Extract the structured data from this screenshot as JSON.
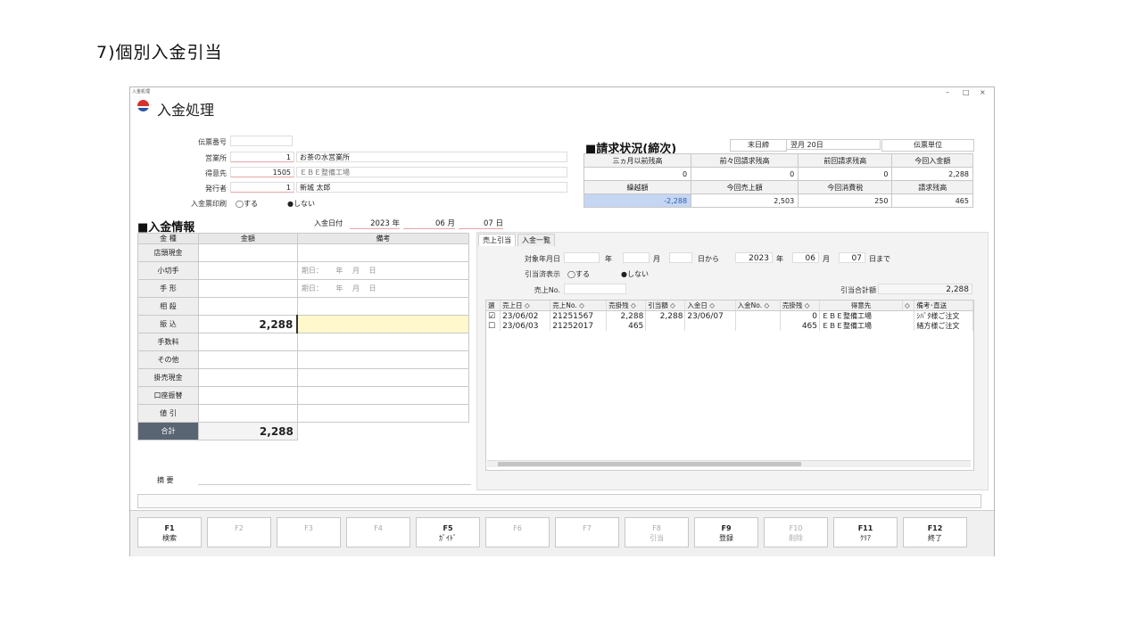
{
  "slide_title": "7)個別入金引当",
  "window": {
    "caption": "入金処理",
    "title": "入金処理",
    "controls": [
      "–",
      "□",
      "×"
    ]
  },
  "header_fields": {
    "slip_no_label": "伝票番号",
    "slip_no": "",
    "office_label": "営業所",
    "office_code": "1",
    "office_name": "お茶の水営業所",
    "customer_label": "得意先",
    "customer_code": "1505",
    "customer_name": "ＥＢＥ整備工場",
    "issuer_label": "発行者",
    "issuer_code": "1",
    "issuer_name": "新城 太郎",
    "print_label": "入金票印刷",
    "print_yes": "◯する",
    "print_no": "●しない"
  },
  "billing": {
    "title": "■請求状況(締次)",
    "close_label": "末日締",
    "pay_label": "翌月 20日",
    "unit_label": "伝票単位",
    "h1": [
      "三ヵ月以前残高",
      "前々回請求残高",
      "前回請求残高",
      "今回入金額"
    ],
    "v1": [
      "0",
      "0",
      "0",
      "2,288"
    ],
    "h2": [
      "繰越額",
      "今回売上額",
      "今回消費税",
      "請求残高"
    ],
    "v2": [
      "-2,288",
      "2,503",
      "250",
      "465"
    ],
    "highlight_color": "#c5d6f2"
  },
  "payment": {
    "title": "■入金情報",
    "date_label": "入金日付",
    "year": "2023",
    "year_unit": "年",
    "month": "06",
    "month_unit": "月",
    "day": "07",
    "day_unit": "日",
    "col_kind": "金 種",
    "col_amount": "金額",
    "col_note": "備考",
    "rows": [
      {
        "kind": "店頭現金",
        "amount": "",
        "note": ""
      },
      {
        "kind": "小切手",
        "amount": "",
        "note": "期日：　　 年　 月　 日"
      },
      {
        "kind": "手 形",
        "amount": "",
        "note": "期日：　　 年　 月　 日"
      },
      {
        "kind": "相 殺",
        "amount": "",
        "note": ""
      },
      {
        "kind": "振 込",
        "amount": "2,288",
        "note": ""
      },
      {
        "kind": "手数料",
        "amount": "",
        "note": ""
      },
      {
        "kind": "その他",
        "amount": "",
        "note": ""
      },
      {
        "kind": "掛売現金",
        "amount": "",
        "note": ""
      },
      {
        "kind": "口座振替",
        "amount": "",
        "note": ""
      },
      {
        "kind": "値 引",
        "amount": "",
        "note": ""
      }
    ],
    "total_label": "合計",
    "total_amount": "2,288",
    "summary_label": "摘 要",
    "summary": ""
  },
  "tabs": [
    "売上引当",
    "入金一覧"
  ],
  "filter": {
    "target_date_label": "対象年月日",
    "year_unit": "年",
    "month_unit": "月",
    "from_label": "日から",
    "to_year": "2023",
    "to_month": "06",
    "to_day": "07",
    "to_label": "日まで",
    "show_label": "引当済表示",
    "show_yes": "◯する",
    "show_no": "●しない",
    "sales_no_label": "売上No.",
    "alloc_total_label": "引当合計額",
    "alloc_total": "2,288"
  },
  "grid": {
    "headers": [
      "選",
      "売上日 ◇",
      "売上No. ◇",
      "売掛残 ◇",
      "引当額 ◇",
      "入金日 ◇",
      "入金No. ◇",
      "売掛残 ◇",
      "得意先",
      "◇",
      "備考･直送"
    ],
    "rows": [
      {
        "sel": "☑",
        "date": "23/06/02",
        "no": "21251567",
        "bal": "2,288",
        "alloc": "2,288",
        "pdate": "23/06/07",
        "pno": "",
        "bal2": "0",
        "cust": "ＥＢＥ整備工場",
        "note": "ｼﾊﾞﾀ様ご注文"
      },
      {
        "sel": "☐",
        "date": "23/06/03",
        "no": "21252017",
        "bal": "465",
        "alloc": "",
        "pdate": "",
        "pno": "",
        "bal2": "465",
        "cust": "ＥＢＥ整備工場",
        "note": "緒方様ご注文"
      }
    ]
  },
  "fkeys": [
    {
      "key": "F1",
      "label": "検索",
      "enabled": true
    },
    {
      "key": "F2",
      "label": "",
      "enabled": false
    },
    {
      "key": "F3",
      "label": "",
      "enabled": false
    },
    {
      "key": "F4",
      "label": "",
      "enabled": false
    },
    {
      "key": "F5",
      "label": "ｶﾞｲﾄﾞ",
      "enabled": true
    },
    {
      "key": "F6",
      "label": "",
      "enabled": false
    },
    {
      "key": "F7",
      "label": "",
      "enabled": false
    },
    {
      "key": "F8",
      "label": "引当",
      "enabled": false
    },
    {
      "key": "F9",
      "label": "登録",
      "enabled": true
    },
    {
      "key": "F10",
      "label": "削除",
      "enabled": false
    },
    {
      "key": "F11",
      "label": "ｸﾘｱ",
      "enabled": true
    },
    {
      "key": "F12",
      "label": "終了",
      "enabled": true
    }
  ]
}
